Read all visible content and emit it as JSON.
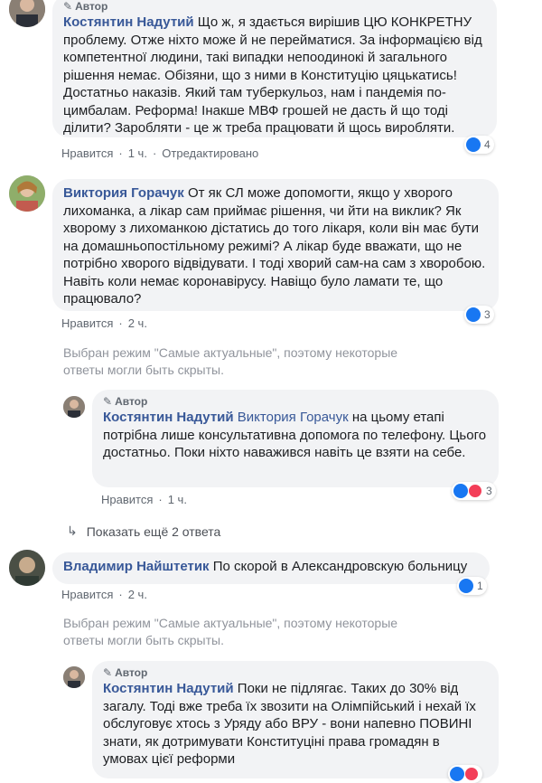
{
  "author_label": "Автор",
  "c1": {
    "name": "Костянтин Надутий",
    "text": "Що ж, я здається вирішив ЦЮ КОНКРЕТНУ проблему. Отже ніхто може й не перейматися. За інформацією від компетентної людини, такі випадки непоодинокі й загального рішення немає. Обізяни, що з ними в Конституцію цяцькатись! Достатньо наказів. Який там туберкульоз, нам і пандемія по-цимбалам. Реформа! Інакше МВФ грошей не дасть й що тоді ділити? Заробляти - це ж треба працювати й щось виробляти.",
    "like": "Нравится",
    "time": "1 ч.",
    "edited": "Отредактировано",
    "reactions": "4"
  },
  "c2": {
    "name": "Виктория Горачук",
    "text": "От як СЛ може допомогти, якщо у хворого лихоманка, а лікар сам приймає рішення, чи йти на виклик? Як хворому з лихоманкою дістатись до того лікаря, коли він має бути на домашньопостільному режимі? А лікар буде вважати, що не потрібно хворого відвідувати. І тоді хворий сам-на сам з хворобою. Навіть коли немає коронавірусу. Навіщо було ламати те, що працювало?",
    "like": "Нравится",
    "time": "2 ч.",
    "reactions": "3"
  },
  "notice1": "Выбран режим \"Самые актуальные\", поэтому некоторые ответы могли быть скрыты.",
  "r1": {
    "name": "Костянтин Надутий",
    "mention": "Виктория Горачук",
    "text": " на цьому етапі потрібна лише консультативна допомога по телефону. Цього достатньо. Поки ніхто наважився навіть це взяти на себе.",
    "like": "Нравится",
    "time": "1 ч.",
    "reactions": "3"
  },
  "more_replies": "Показать ещё 2 ответа",
  "c3": {
    "name": "Владимир Найштетик",
    "text": "По скорой в Александровскую больницу",
    "like": "Нравится",
    "time": "2 ч.",
    "reactions": "1"
  },
  "notice2": "Выбран режим \"Самые актуальные\", поэтому некоторые ответы могли быть скрыты.",
  "r2": {
    "name": "Костянтин Надутий",
    "text": "Поки не підлягає. Таких до 30% від загалу. Тоді вже треба їх звозити на Олімпійський і нехай їх обслуговує хтось з Уряду або ВРУ - вони напевно ПОВИНІ знати, як дотримувати Конституціні права громадян в умовах цієї реформи"
  },
  "sep": "·"
}
